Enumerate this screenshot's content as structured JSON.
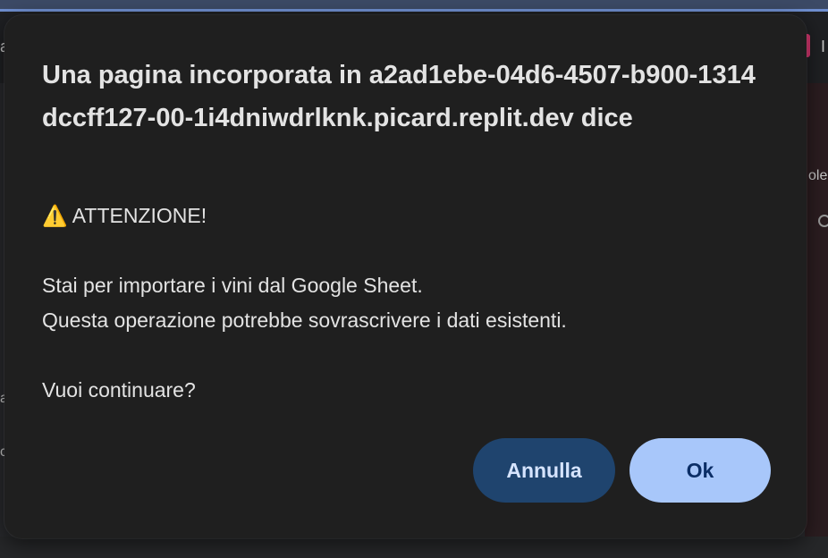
{
  "dialog": {
    "title": "Una pagina incorporata in a2ad1ebe-04d6-4507-b900-1314dccff127-00-1i4dniwdrlknk.picard.replit.dev dice",
    "message": "⚠️ ATTENZIONE!\n\nStai per importare i vini dal Google Sheet.\nQuesta operazione potrebbe sovrascrivere i dati esistenti.\n\nVuoi continuare?",
    "cancel_label": "Annulla",
    "ok_label": "Ok"
  },
  "background": {
    "top_left_glyph": "a",
    "top_right_glyph": "I",
    "right_fragment": "ole",
    "left_fragment_1": "a",
    "left_fragment_2": "c"
  },
  "colors": {
    "dialog_bg": "#1f1f1f",
    "text": "#e3e3e3",
    "cancel_bg": "#1f446e",
    "ok_bg": "#a8c7fa",
    "ok_text": "#0b2e66"
  }
}
